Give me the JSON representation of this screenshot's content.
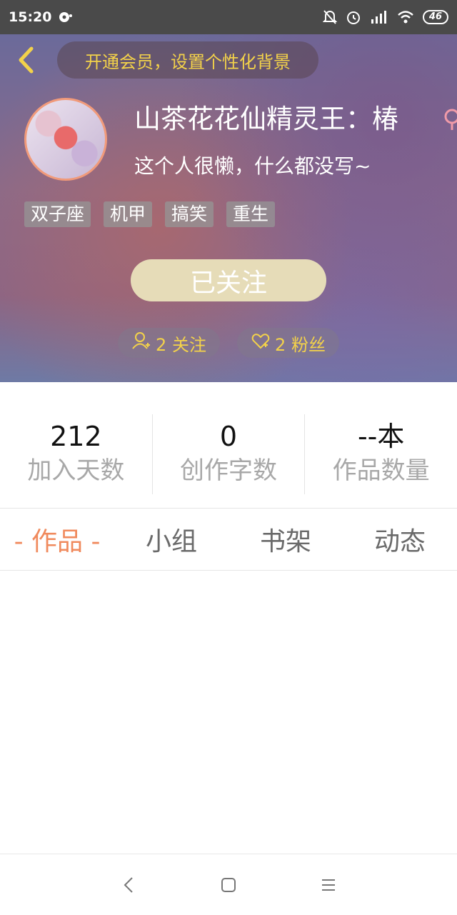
{
  "status_bar": {
    "time": "15:20",
    "battery": "46",
    "icons": [
      "media-icon",
      "mute-bell-icon",
      "alarm-icon",
      "hd-signal-icon",
      "wifi-icon",
      "battery-icon"
    ]
  },
  "header": {
    "vip_prompt": "开通会员，设置个性化背景",
    "username": "山茶花花仙精灵王：椿",
    "bio": "这个人很懒，什么都没写~",
    "tags": [
      "双子座",
      "机甲",
      "搞笑",
      "重生"
    ],
    "follow_button_label": "已关注",
    "following_text": "2 关注",
    "fans_text": "2 粉丝",
    "colors": {
      "vip_text": "#f3d24a",
      "follow_button": "#e6dcb8",
      "avatar_border": "#f19a7a"
    }
  },
  "counts": [
    {
      "value": "212",
      "label": "加入天数"
    },
    {
      "value": "0",
      "label": "创作字数"
    },
    {
      "value": "--本",
      "label": "作品数量"
    }
  ],
  "tabs": [
    {
      "label": "- 作品 -",
      "active": true
    },
    {
      "label": "小组",
      "active": false
    },
    {
      "label": "书架",
      "active": false
    },
    {
      "label": "动态",
      "active": false
    }
  ],
  "accent_color": "#f08a5d",
  "nav_bar": {
    "icons": [
      "back-nav-icon",
      "home-nav-icon",
      "menu-nav-icon"
    ]
  }
}
